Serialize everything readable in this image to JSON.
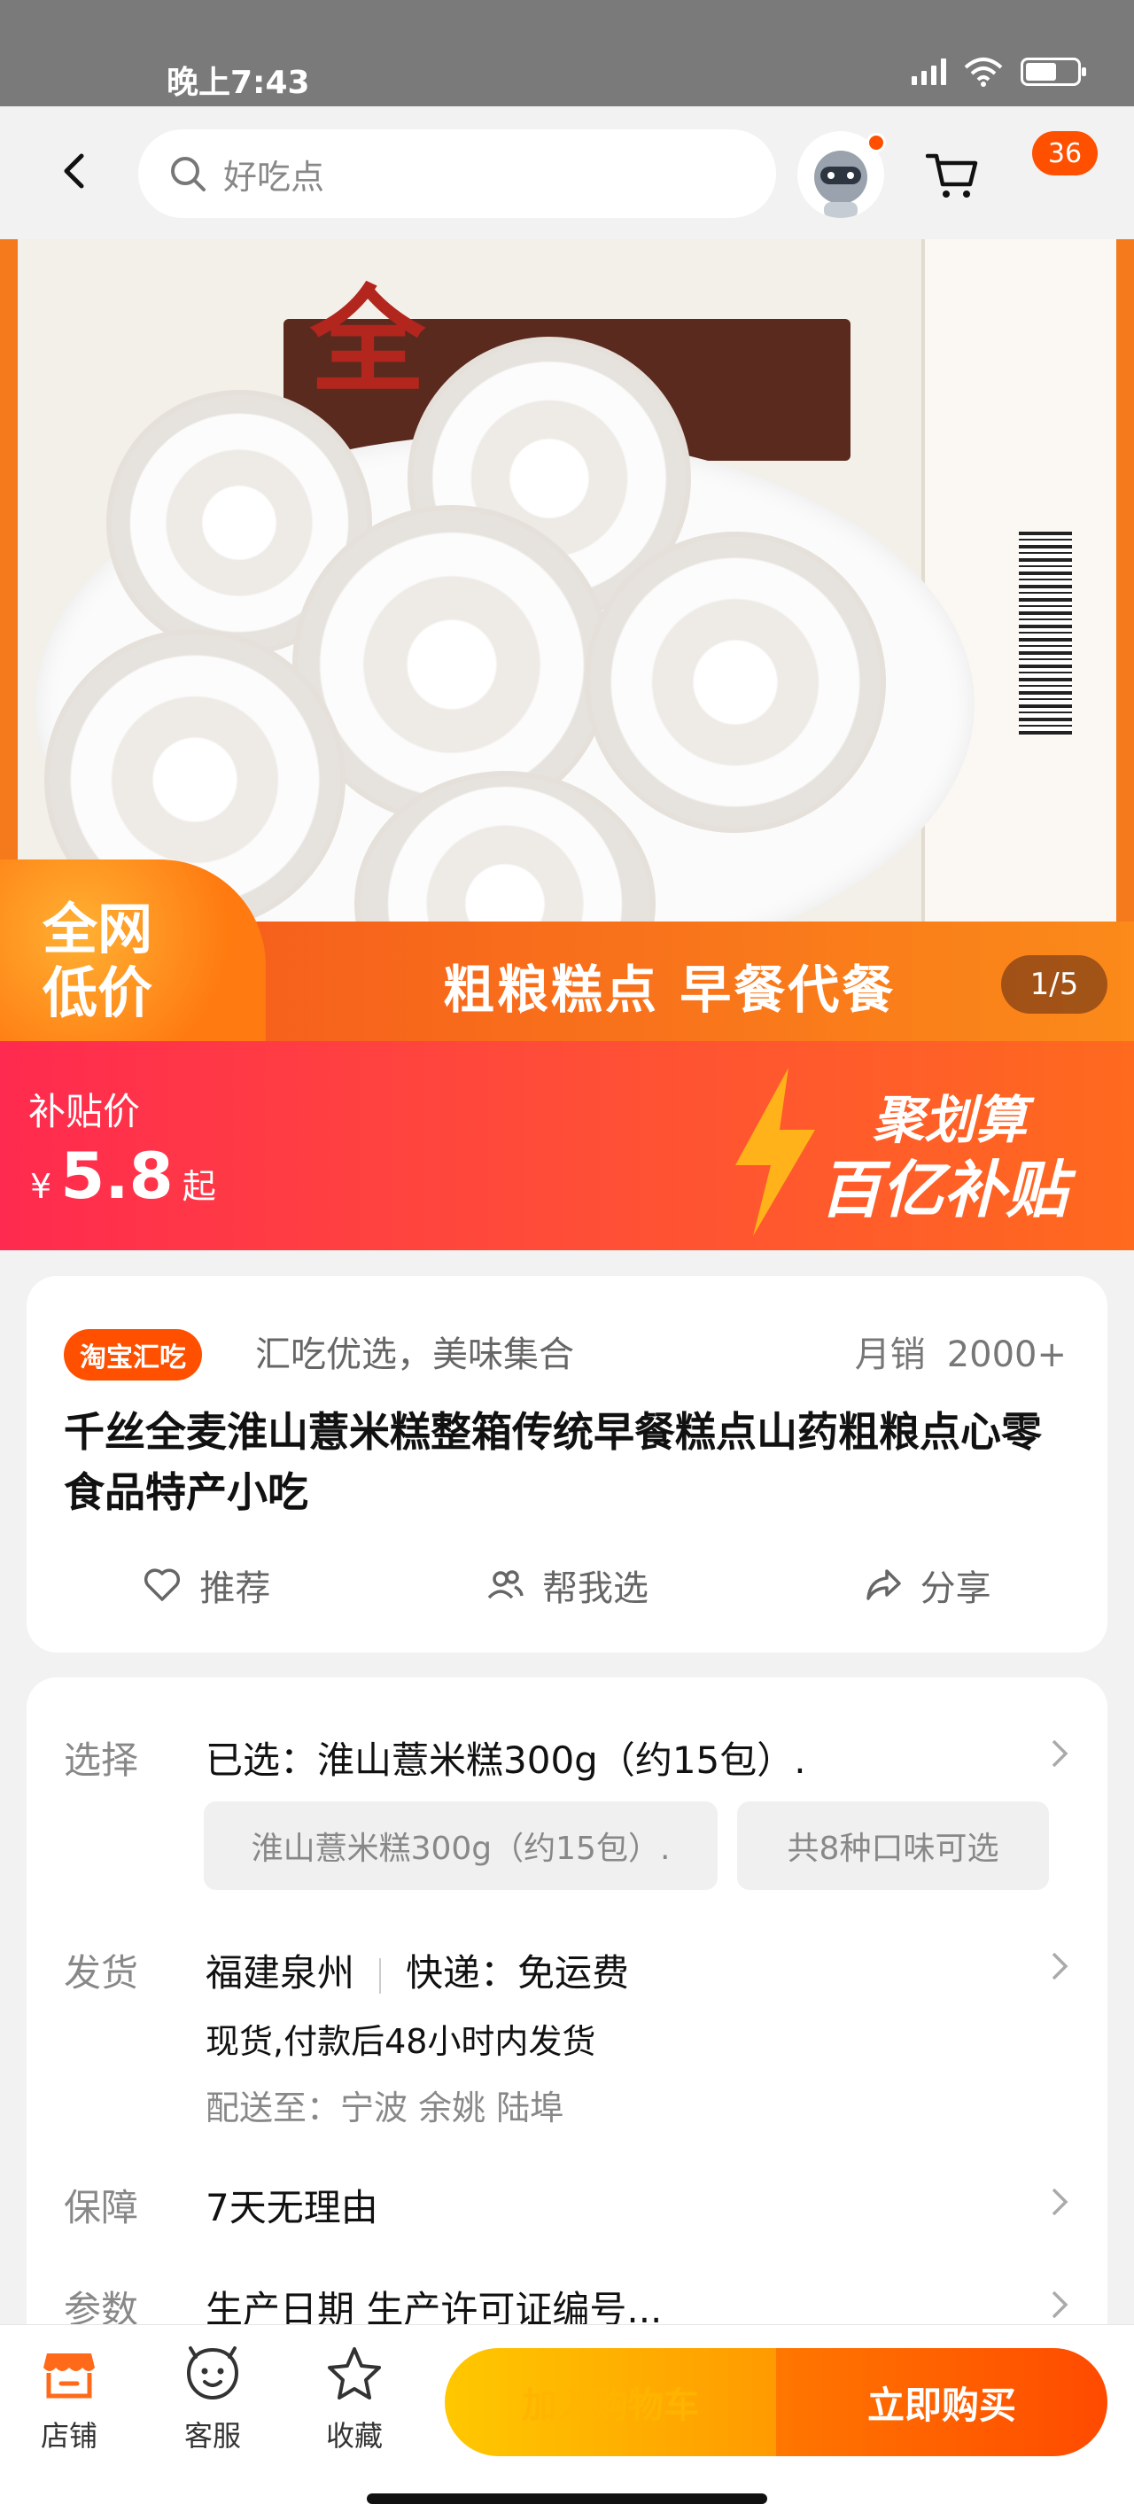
{
  "status_bar": {
    "time": "晚上7:43",
    "battery_level": 0.6
  },
  "nav": {
    "search_placeholder": "好吃点",
    "cart_badge": "36"
  },
  "hero": {
    "strip_text": "粗粮糕点 早餐代餐",
    "low_price_line1": "全网",
    "low_price_line2": "低价",
    "pager": "1/5",
    "brand_char": "全"
  },
  "subsidy": {
    "label": "补贴价",
    "currency": "¥",
    "price": "5.8",
    "suffix": "起",
    "brand_line1": "聚划算",
    "brand_line2": "百亿补贴"
  },
  "product": {
    "shop_tag": "淘宝汇吃",
    "shop_slogan": "汇吃优选，美味集合",
    "sales_label": "月销",
    "sales_value": "2000+",
    "title": "千丝全麦淮山薏米糕整箱传统早餐糕点山药粗粮点心零食品特产小吃",
    "actions": [
      {
        "label": "推荐",
        "icon": "heart-icon"
      },
      {
        "label": "帮我选",
        "icon": "people-icon"
      },
      {
        "label": "分享",
        "icon": "share-icon"
      }
    ]
  },
  "details": {
    "select": {
      "label": "选择",
      "value": "已选：淮山薏米糕300g（约15包）.",
      "option1": "淮山薏米糕300g（约15包）.",
      "option2": "共8种口味可选"
    },
    "ship": {
      "label": "发货",
      "origin": "福建泉州",
      "express": "快递：免运费",
      "timing": "现货,付款后48小时内发货",
      "deliver_to": "配送至：宁波 余姚 陆埠"
    },
    "guarantee": {
      "label": "保障",
      "value": "7天无理由"
    },
    "params": {
      "label": "参数",
      "value": "生产日期 生产许可证编号..."
    }
  },
  "bottom_bar": {
    "items": [
      {
        "label": "店铺",
        "icon": "store-icon"
      },
      {
        "label": "客服",
        "icon": "service-icon"
      },
      {
        "label": "收藏",
        "icon": "star-icon"
      }
    ],
    "add_cart": "加入购物车",
    "buy_now": "立即购买"
  },
  "colors": {
    "brand": "#ff5000",
    "subsidy_start": "#ff2a4f",
    "buy": "#ff5a00",
    "cart": "#ffb400"
  }
}
